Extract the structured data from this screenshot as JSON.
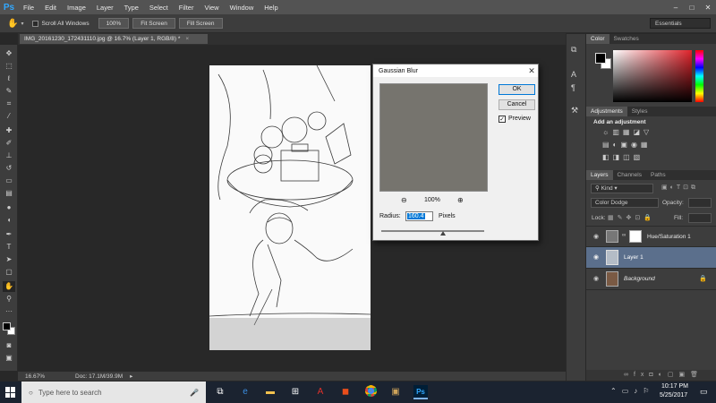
{
  "app": {
    "logo": "Ps"
  },
  "menu": {
    "items": [
      "File",
      "Edit",
      "Image",
      "Layer",
      "Type",
      "Select",
      "Filter",
      "View",
      "Window",
      "Help"
    ]
  },
  "window_controls": {
    "minimize": "–",
    "maximize": "□",
    "close": "✕"
  },
  "options_bar": {
    "scroll_all_windows": "Scroll All Windows",
    "zoom_100": "100%",
    "fit_screen": "Fit Screen",
    "fill_screen": "Fill Screen",
    "workspace": "Essentials"
  },
  "document": {
    "tab_title": "IMG_20161230_172431110.jpg @ 16.7% (Layer 1, RGB/8) *",
    "close": "×"
  },
  "status_bar": {
    "zoom": "16.67%",
    "doc_size": "Doc: 17.1M/39.9M"
  },
  "dialog": {
    "title": "Gaussian Blur",
    "ok": "OK",
    "cancel": "Cancel",
    "preview_label": "Preview",
    "preview_checked": true,
    "zoom_level": "100%",
    "radius_label": "Radius:",
    "radius_value": "160.4",
    "radius_unit": "Pixels",
    "radius_slider_fraction": 0.6
  },
  "panels": {
    "color_tabs": [
      "Color",
      "Swatches"
    ],
    "adjustments_tabs": [
      "Adjustments",
      "Styles"
    ],
    "add_adjustment": "Add an adjustment",
    "layers_tabs": [
      "Layers",
      "Channels",
      "Paths"
    ],
    "kind_filter": "Kind",
    "blend_mode": "Color Dodge",
    "opacity_label": "Opacity:",
    "lock_label": "Lock:",
    "fill_label": "Fill:",
    "layers": [
      {
        "name": "Hue/Saturation 1",
        "selected": false,
        "italic": false
      },
      {
        "name": "Layer 1",
        "selected": true,
        "italic": false
      },
      {
        "name": "Background",
        "selected": false,
        "italic": true
      }
    ]
  },
  "taskbar": {
    "search_placeholder": "Type here to search",
    "time": "10:17 PM",
    "date": "5/25/2017",
    "pinned": [
      "task-view",
      "edge",
      "file-explorer",
      "store",
      "acrobat",
      "office",
      "chrome",
      "gallery",
      "photoshop"
    ]
  },
  "colors": {
    "accent": "#31a8ff",
    "selected_layer": "#5b6f8c",
    "taskbar": "#1b2330"
  }
}
